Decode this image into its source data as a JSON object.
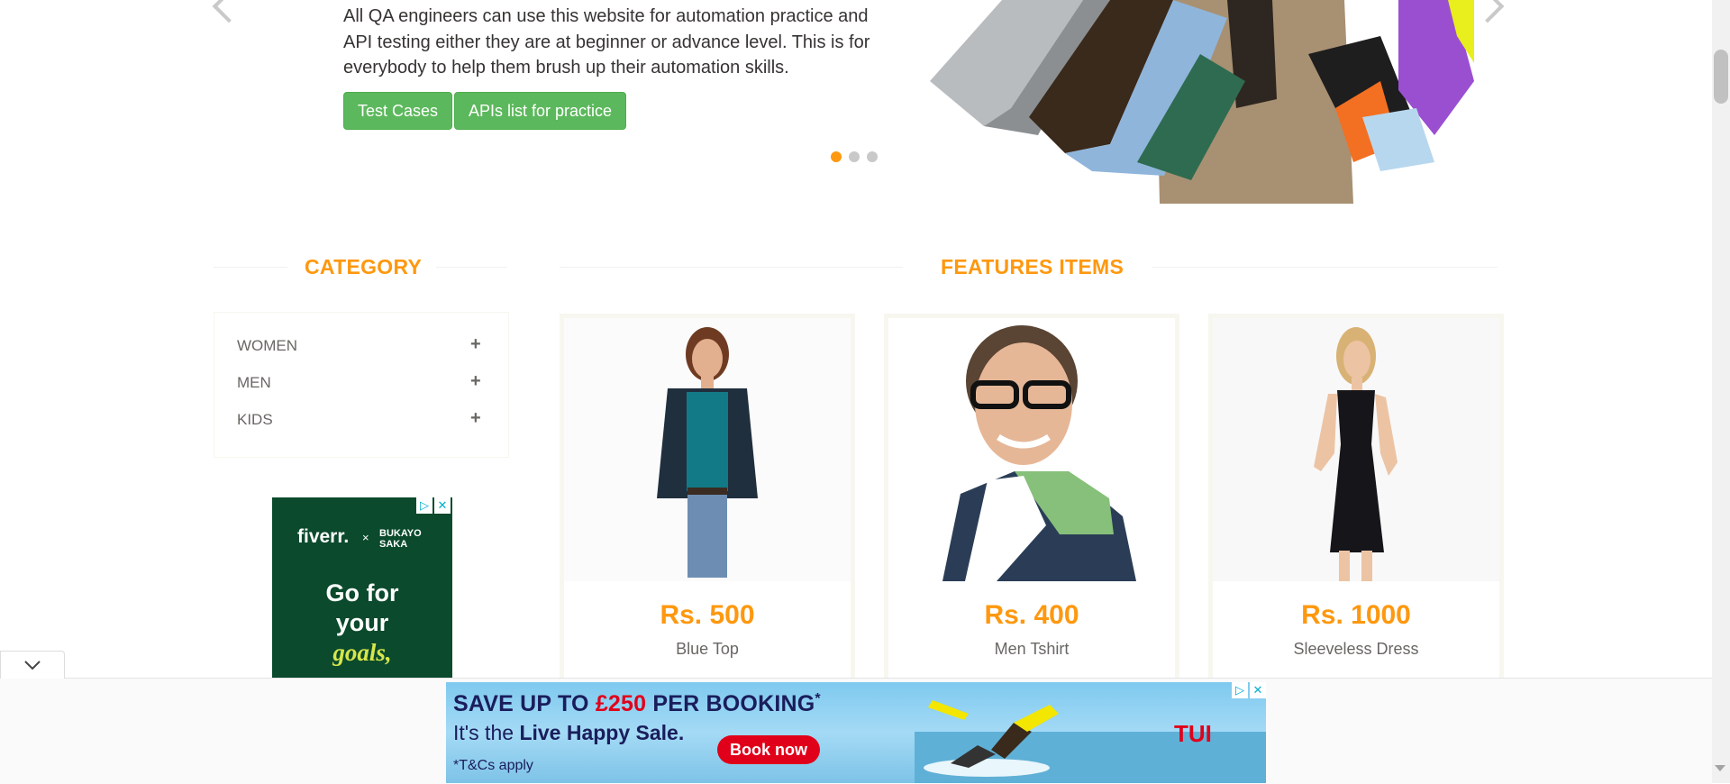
{
  "hero": {
    "description": "All QA engineers can use this website for automation practice and API testing either they are at beginner or advance level. This is for everybody to help them brush up their automation skills.",
    "buttons": [
      "Test Cases",
      "APIs list for practice"
    ]
  },
  "category": {
    "title": "CATEGORY",
    "items": [
      {
        "label": "WOMEN",
        "toggle": "+"
      },
      {
        "label": "MEN",
        "toggle": "+"
      },
      {
        "label": "KIDS",
        "toggle": "+"
      }
    ]
  },
  "fiverr_ad": {
    "brand": "fiverr.",
    "cross": "×",
    "partner_line1": "BUKAYO",
    "partner_line2": "SAKA",
    "headline_1": "Go for",
    "headline_2": "your",
    "headline_3": "goals,",
    "ad_choices": "▷",
    "close": "✕"
  },
  "features": {
    "title": "FEATURES ITEMS",
    "products": [
      {
        "price": "Rs. 500",
        "name": "Blue Top"
      },
      {
        "price": "Rs. 400",
        "name": "Men Tshirt"
      },
      {
        "price": "Rs. 1000",
        "name": "Sleeveless Dress"
      }
    ]
  },
  "tui_ad": {
    "line1_a": "SAVE UP TO ",
    "line1_amount": "£250",
    "line1_b": " PER BOOKING",
    "line1_star": "*",
    "line2_a": "It's the ",
    "line2_b": "Live Happy Sale.",
    "book_button": "Book now",
    "terms": "*T&Cs apply",
    "logo": "TUI",
    "ad_choices": "▷",
    "close": "✕"
  },
  "collapse_icon": "chevron-down-icon",
  "colors": {
    "accent": "#fe980f",
    "button_green": "#5cb85c",
    "text": "#696763",
    "fiverr_green": "#0b4a2c",
    "tui_red": "#e1001a",
    "tui_navy": "#1a1d5c"
  }
}
